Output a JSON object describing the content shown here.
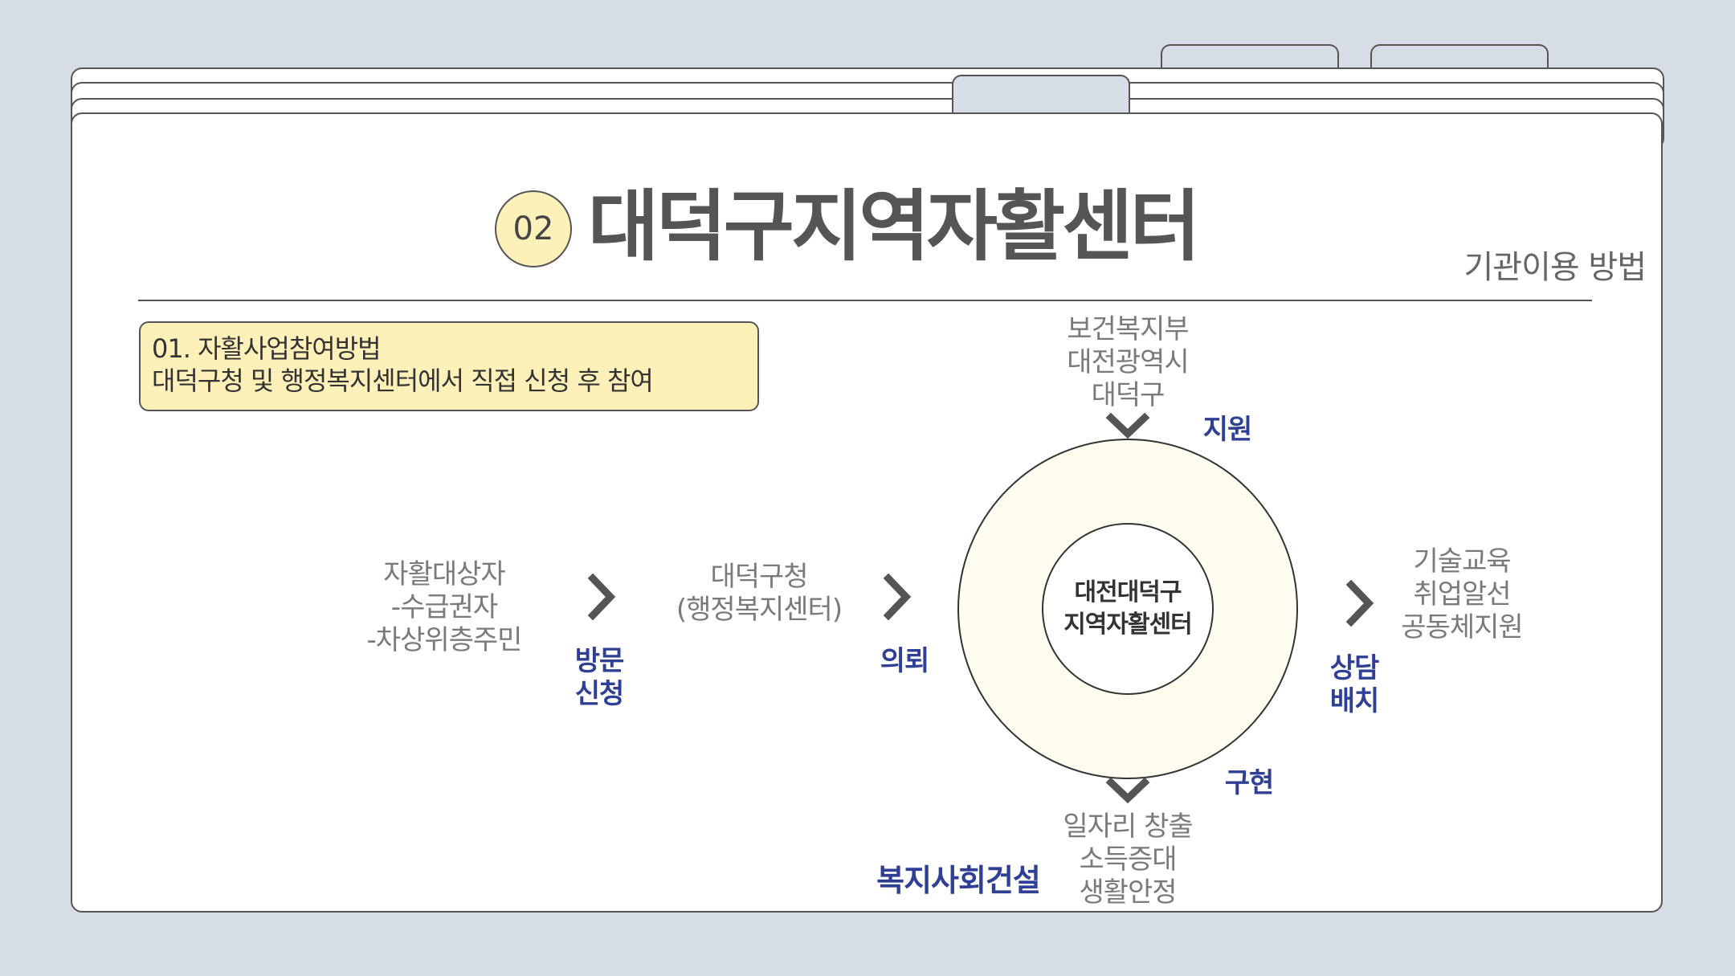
{
  "title": {
    "number": "02",
    "main": "대덕구지역자활센터",
    "sub": "기관이용 방법"
  },
  "note": {
    "line1": "01. 자활사업참여방법",
    "line2": "대덕구청 및 행정복지센터에서 직접 신청 후 참여"
  },
  "diagram": {
    "target": [
      "자활대상자",
      "-수급권자",
      "-차상위층주민"
    ],
    "step1_label": [
      "방문",
      "신청"
    ],
    "office": [
      "대덕구청",
      "(행정복지센터)"
    ],
    "step2_label": "의뢰",
    "support_orgs": [
      "보건복지부",
      "대전광역시",
      "대덕구"
    ],
    "support_label": "지원",
    "center": [
      "대전대덕구",
      "지역자활센터"
    ],
    "step3_label": [
      "상담",
      "배치"
    ],
    "services": [
      "기술교육",
      "취업알선",
      "공동체지원"
    ],
    "realize_label": "구현",
    "outcomes": [
      "일자리 창출",
      "소득증대",
      "생활안정"
    ],
    "goal": "복지사회건설"
  },
  "colors": {
    "background": "#d6dde6",
    "accent_yellow": "#fdf0b9",
    "label_blue": "#2f3f95",
    "text_gray": "#7a7a7a"
  }
}
